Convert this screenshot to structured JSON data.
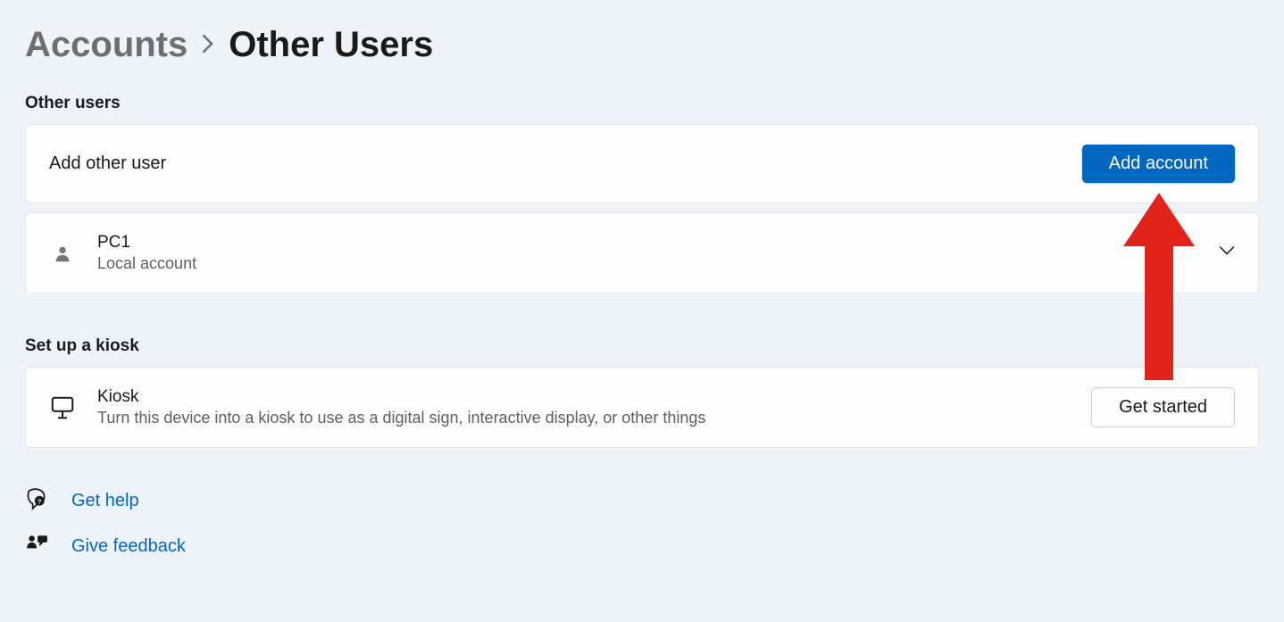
{
  "breadcrumb": {
    "parent": "Accounts",
    "current": "Other Users"
  },
  "sections": {
    "otherUsers": {
      "header": "Other users",
      "addRow": {
        "label": "Add other user",
        "button": "Add account"
      },
      "user": {
        "name": "PC1",
        "type": "Local account"
      }
    },
    "kiosk": {
      "header": "Set up a kiosk",
      "title": "Kiosk",
      "description": "Turn this device into a kiosk to use as a digital sign, interactive display, or other things",
      "button": "Get started"
    }
  },
  "links": {
    "help": "Get help",
    "feedback": "Give feedback"
  }
}
